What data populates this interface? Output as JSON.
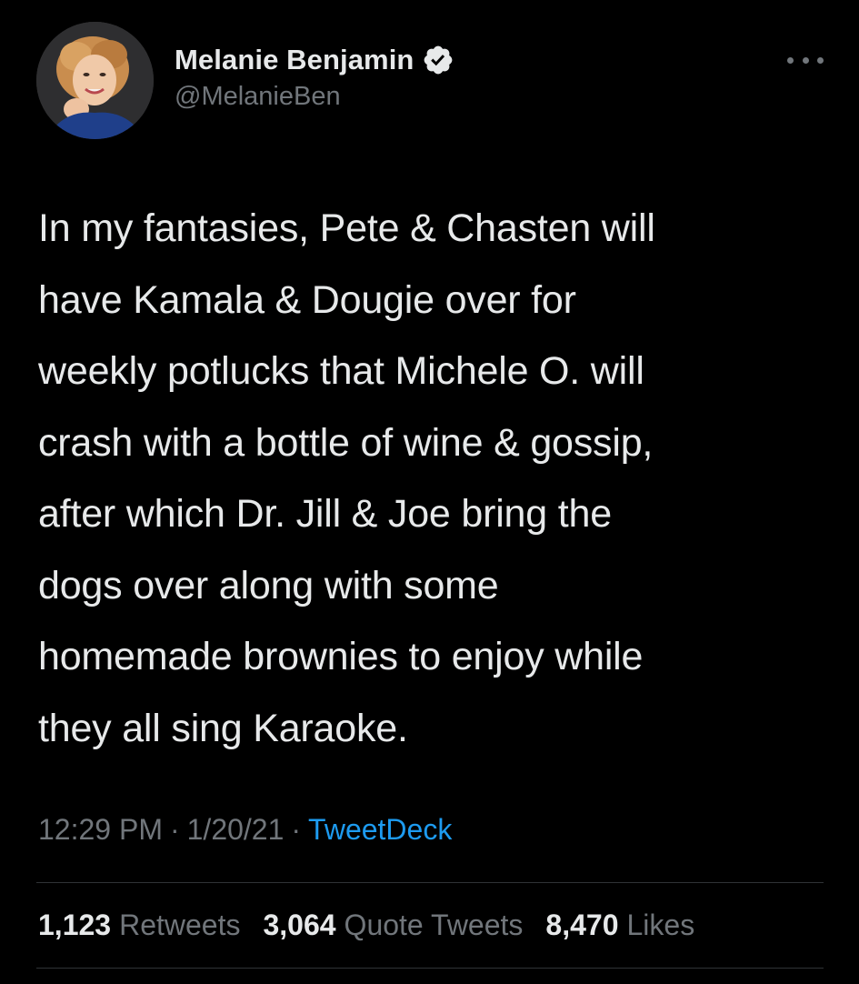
{
  "tweet": {
    "author": {
      "display_name": "Melanie Benjamin",
      "handle": "@MelanieBen",
      "verified": true
    },
    "text_lines": [
      "In my fantasies, Pete & Chasten will",
      "have Kamala & Dougie over for",
      "weekly potlucks that Michele O. will",
      "crash with a bottle of wine & gossip,",
      "after which Dr. Jill & Joe bring the",
      "dogs over along with some",
      "homemade brownies to enjoy while",
      "they all sing Karaoke."
    ],
    "meta": {
      "time": "12:29 PM",
      "date": "1/20/21",
      "source": "TweetDeck",
      "separator": "·"
    },
    "stats": {
      "retweets_count": "1,123",
      "retweets_label": "Retweets",
      "quotes_count": "3,064",
      "quotes_label": "Quote Tweets",
      "likes_count": "8,470",
      "likes_label": "Likes"
    }
  },
  "colors": {
    "background": "#000000",
    "primary_text": "#e7e9ea",
    "secondary_text": "#71767b",
    "accent": "#1d9bf0",
    "divider": "#2f3336"
  },
  "icons": {
    "verified": "verified-badge-icon",
    "more": "more-options-icon"
  }
}
